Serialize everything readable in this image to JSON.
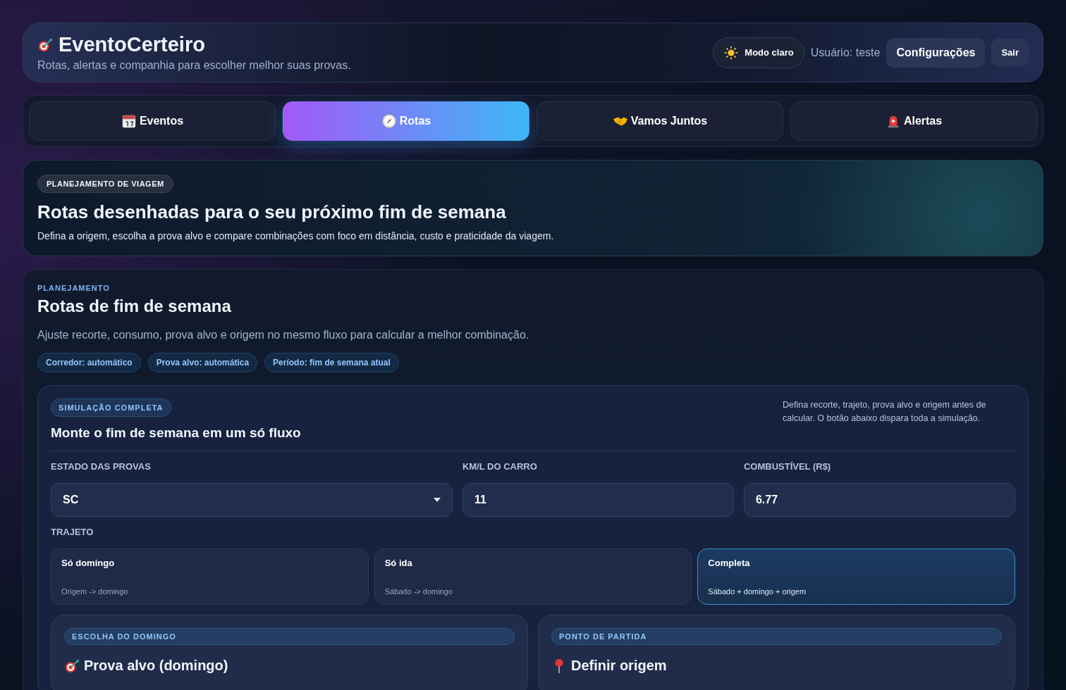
{
  "header": {
    "brand": "EventoCerteiro",
    "tagline": "Rotas, alertas e companhia para escolher melhor suas provas.",
    "theme_button": "Modo claro",
    "user": "Usuário: teste",
    "settings_button": "Configurações",
    "logout_button": "Sair"
  },
  "tabs": [
    {
      "kind": "calendar",
      "label": "Eventos",
      "selected": false
    },
    {
      "kind": "compass",
      "label": "Rotas",
      "selected": true
    },
    {
      "kind": "handshake",
      "label": "Vamos Juntos",
      "selected": false
    },
    {
      "kind": "siren",
      "label": "Alertas",
      "selected": false
    }
  ],
  "hero": {
    "badge": "PLANEJAMENTO DE VIAGEM",
    "title": "Rotas desenhadas para o seu próximo fim de semana",
    "subtitle": "Defina a origem, escolha a prova alvo e compare combinações com foco em distância, custo e praticidade da viagem."
  },
  "planner": {
    "eyebrow": "PLANEJAMENTO",
    "title": "Rotas de fim de semana",
    "description": "Ajuste recorte, consumo, prova alvo e origem no mesmo fluxo para calcular a melhor combinação.",
    "chips": [
      "Corredor: automático",
      "Prova alvo: automática",
      "Período: fim de semana atual"
    ],
    "simulation": {
      "badge": "SIMULAÇÃO COMPLETA",
      "title": "Monte o fim de semana em um só fluxo",
      "note": "Defina recorte, trajeto, prova alvo e origem antes de calcular. O botão abaixo dispara toda a simulação.",
      "fields": [
        {
          "kind": "select",
          "label": "ESTADO DAS PROVAS",
          "value": "SC"
        },
        {
          "kind": "input",
          "label": "KM/L DO CARRO",
          "value": "11"
        },
        {
          "kind": "input",
          "label": "COMBUSTÍVEL (R$)",
          "value": "6.77"
        }
      ],
      "route_label": "TRAJETO",
      "routes": [
        {
          "title": "Só domingo",
          "detail": "Origem -> domingo",
          "selected": false
        },
        {
          "title": "Só ida",
          "detail": "Sábado -> domingo",
          "selected": false
        },
        {
          "title": "Completa",
          "detail": "Sábado + domingo + origem",
          "selected": true
        }
      ],
      "cards": [
        {
          "kind": "target",
          "badge": "ESCOLHA DO DOMINGO",
          "title": "Prova alvo (domingo)"
        },
        {
          "kind": "pin",
          "badge": "PONTO DE PARTIDA",
          "title": "Definir origem"
        }
      ]
    }
  }
}
